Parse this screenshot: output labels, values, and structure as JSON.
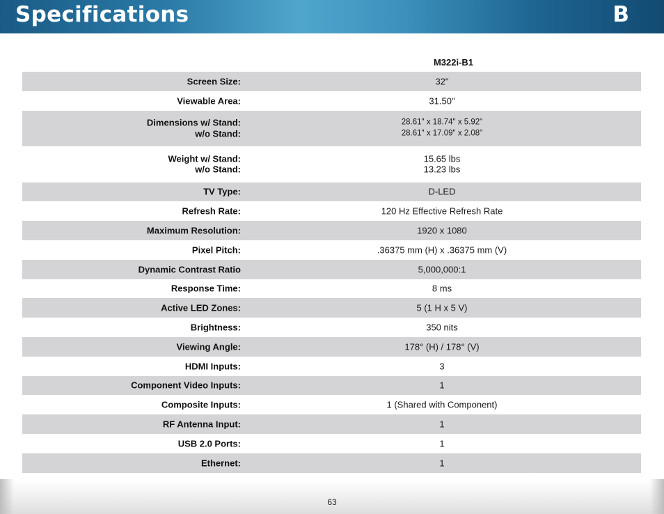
{
  "header": {
    "title": "Specifications",
    "appendix_letter": "B",
    "gradient_colors": [
      "#1a5b86",
      "#4fa6cc",
      "#124a72"
    ]
  },
  "model": "M322i-B1",
  "rows": [
    {
      "label": "Screen Size:",
      "value": "32\""
    },
    {
      "label": "Viewable Area:",
      "value": "31.50\""
    },
    {
      "label_lines": [
        "Dimensions w/ Stand:",
        "w/o Stand:"
      ],
      "value_lines": [
        "28.61\" x 18.74\" x 5.92\"",
        "28.61\" x 17.09\" x 2.08\""
      ]
    },
    {
      "label_lines": [
        "Weight w/ Stand:",
        "w/o Stand:"
      ],
      "value_lines": [
        "15.65 lbs",
        "13.23 lbs"
      ]
    },
    {
      "label": "TV Type:",
      "value": "D-LED"
    },
    {
      "label": "Refresh Rate:",
      "value": "120 Hz Effective Refresh Rate"
    },
    {
      "label": "Maximum Resolution:",
      "value": "1920 x 1080"
    },
    {
      "label": "Pixel Pitch:",
      "value": ".36375 mm (H) x .36375 mm (V)"
    },
    {
      "label": "Dynamic Contrast Ratio",
      "value": "5,000,000:1"
    },
    {
      "label": "Response Time:",
      "value": "8 ms"
    },
    {
      "label": "Active LED Zones:",
      "value": "5 (1 H x 5 V)"
    },
    {
      "label": "Brightness:",
      "value": "350 nits"
    },
    {
      "label": "Viewing Angle:",
      "value": "178° (H) / 178° (V)"
    },
    {
      "label": "HDMI Inputs:",
      "value": "3"
    },
    {
      "label": "Component Video Inputs:",
      "value": "1"
    },
    {
      "label": "Composite Inputs:",
      "value": "1 (Shared with Component)"
    },
    {
      "label": "RF Antenna Input:",
      "value": "1"
    },
    {
      "label": "USB 2.0 Ports:",
      "value": "1"
    },
    {
      "label": "Ethernet:",
      "value": "1"
    }
  ],
  "row_shade_color": "#d4d4d6",
  "footer": {
    "page_number": "63"
  }
}
